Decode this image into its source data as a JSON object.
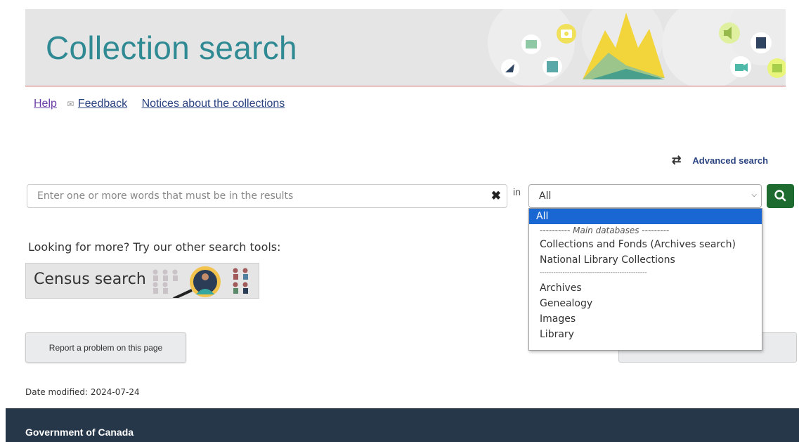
{
  "banner": {
    "title": "Collection search"
  },
  "links": {
    "help": "Help",
    "feedback": "Feedback",
    "notices": "Notices about the collections"
  },
  "advanced_search": {
    "label": "Advanced search"
  },
  "search": {
    "placeholder": "Enter one or more words that must be in the results",
    "in_label": "in",
    "selected": "All"
  },
  "dropdown": {
    "options": [
      {
        "label": "All",
        "selected": true
      },
      {
        "label": "---------- Main databases ---------",
        "type": "group"
      },
      {
        "label": "Collections and Fonds (Archives search)"
      },
      {
        "label": "National Library Collections"
      },
      {
        "label": "-----------------------------------------------",
        "type": "separator"
      },
      {
        "label": "Archives"
      },
      {
        "label": "Genealogy"
      },
      {
        "label": "Images"
      },
      {
        "label": "Library"
      }
    ]
  },
  "more_tools": {
    "text": "Looking for more? Try our other search tools:",
    "census_label": "Census search"
  },
  "report": {
    "label": "Report a problem on this page"
  },
  "date_modified": "Date modified: 2024-07-24",
  "footer": {
    "title": "Government of Canada"
  },
  "colors": {
    "banner_bg": "#e5e5e5",
    "title": "#2f8a93",
    "go_button": "#1d6b2f",
    "dropdown_selected": "#1967d2",
    "footer_bg": "#26374a"
  },
  "icons": [
    "search-icon",
    "clear-icon",
    "swap-icon",
    "mail-icon",
    "chevron-down-icon",
    "camera-icon",
    "speaker-icon",
    "book-icon",
    "map-icon",
    "video-camera-icon",
    "picture-icon",
    "feather-icon",
    "archive-box-icon",
    "maple-leaf-icon"
  ]
}
